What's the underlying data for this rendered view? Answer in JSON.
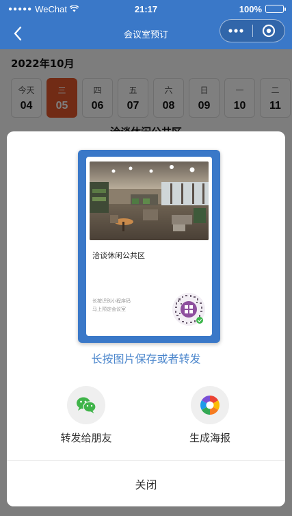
{
  "status_bar": {
    "signal": "●●●●●",
    "carrier": "WeChat",
    "time": "21:17",
    "battery": "100%"
  },
  "nav": {
    "title": "会议室预订",
    "menu_icon": "more-dots-icon",
    "close_icon": "target-icon"
  },
  "page": {
    "month": "2022年10月",
    "dates": [
      {
        "weekday": "今天",
        "day": "04",
        "selected": false
      },
      {
        "weekday": "三",
        "day": "05",
        "selected": true
      },
      {
        "weekday": "四",
        "day": "06",
        "selected": false
      },
      {
        "weekday": "五",
        "day": "07",
        "selected": false
      },
      {
        "weekday": "六",
        "day": "08",
        "selected": false
      },
      {
        "weekday": "日",
        "day": "09",
        "selected": false
      },
      {
        "weekday": "一",
        "day": "10",
        "selected": false
      },
      {
        "weekday": "二",
        "day": "11",
        "selected": false
      }
    ],
    "venue_peek": "洽谈休闲公共区"
  },
  "sheet": {
    "poster": {
      "venue": "洽谈休闲公共区",
      "hint_line1": "长按识别小程序码",
      "hint_line2": "马上预定会议室"
    },
    "save_hint": "长按图片保存或者转发",
    "options": [
      {
        "label": "转发给朋友",
        "icon": "wechat-icon"
      },
      {
        "label": "生成海报",
        "icon": "aperture-icon"
      }
    ],
    "close_label": "关闭"
  },
  "colors": {
    "brand": "#3a78c8",
    "selected_date": "#e2572a",
    "link": "#4b86cc"
  }
}
